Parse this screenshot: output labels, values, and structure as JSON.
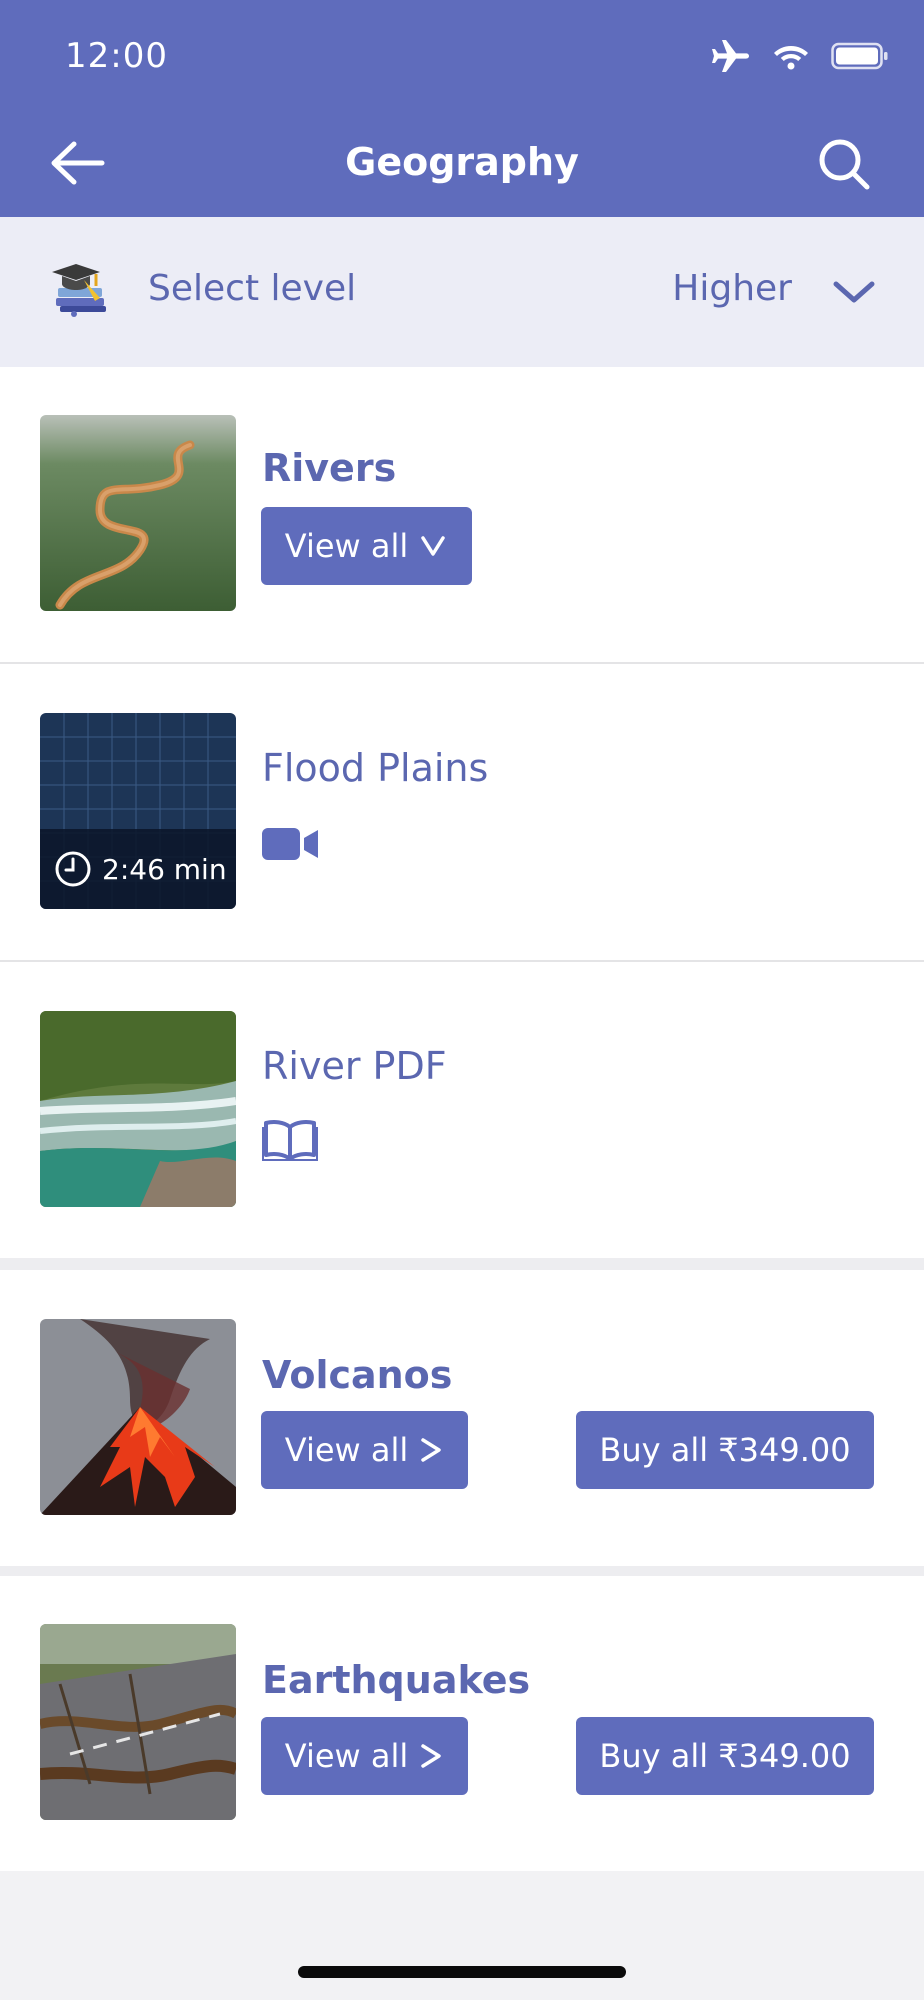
{
  "status_bar": {
    "time": "12:00"
  },
  "header": {
    "title": "Geography"
  },
  "level_selector": {
    "label": "Select level",
    "value": "Higher"
  },
  "sections": {
    "rivers": {
      "title": "Rivers",
      "view_all": "View all"
    },
    "flood_plains": {
      "title": "Flood Plains",
      "duration": "2:46 min"
    },
    "river_pdf": {
      "title": "River PDF"
    },
    "volcanos": {
      "title": "Volcanos",
      "view_all": "View all",
      "buy_all": "Buy all ₹349.00"
    },
    "earthquakes": {
      "title": "Earthquakes",
      "view_all": "View all",
      "buy_all": "Buy all ₹349.00"
    }
  },
  "colors": {
    "accent": "#5f6cbc",
    "level_bg": "#ecedf6",
    "text_accent": "#5b67b0"
  }
}
